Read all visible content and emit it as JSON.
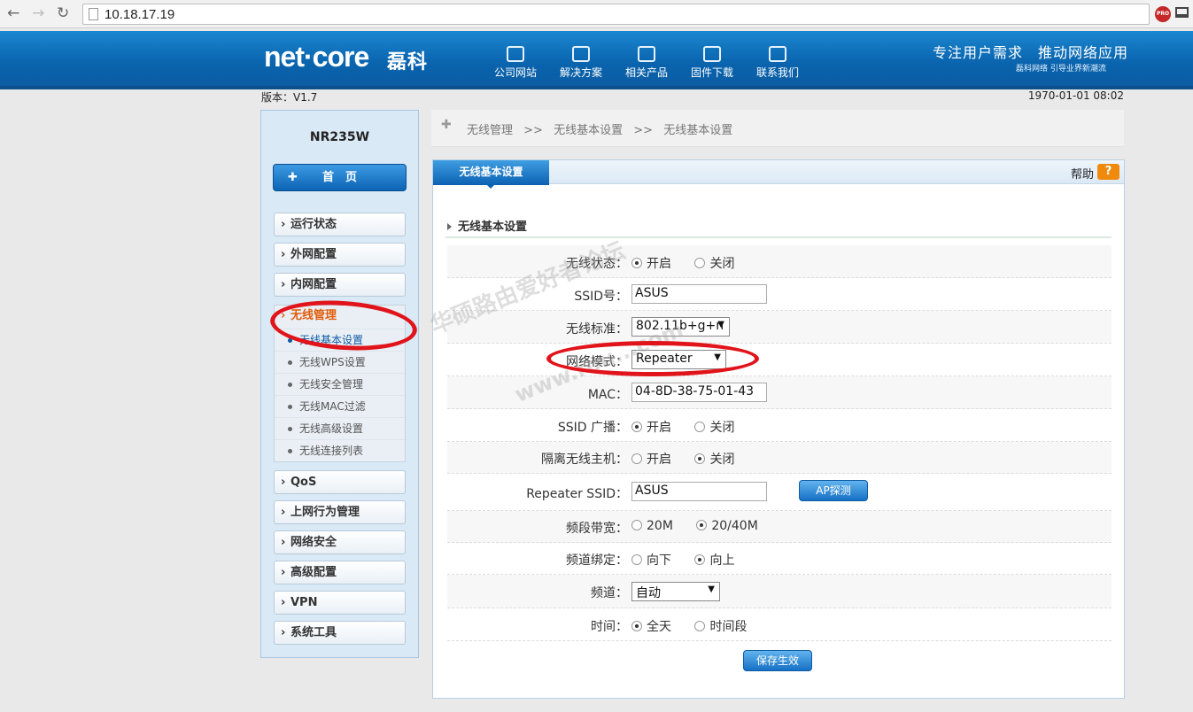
{
  "browser": {
    "url": "10.18.17.19",
    "ext_badge": "PRO"
  },
  "header": {
    "logo_text": "net·core",
    "logo_cn": "磊科",
    "nav": [
      "公司网站",
      "解决方案",
      "相关产品",
      "固件下载",
      "联系我们"
    ],
    "slogan": "专注用户需求　推动网络应用",
    "slogan_sub": "磊科网络 引导业界新潮流"
  },
  "meta": {
    "version": "版本：V1.7",
    "datetime": "1970-01-01 08:02"
  },
  "sidebar": {
    "device": "NR235W",
    "home": "首　页",
    "menu_top": [
      "运行状态",
      "外网配置",
      "内网配置"
    ],
    "open_menu": "无线管理",
    "sub_items": [
      "无线基本设置",
      "无线WPS设置",
      "无线安全管理",
      "无线MAC过滤",
      "无线高级设置",
      "无线连接列表"
    ],
    "menu_bottom": [
      "QoS",
      "上网行为管理",
      "网络安全",
      "高级配置",
      "VPN",
      "系统工具"
    ]
  },
  "breadcrumb": [
    "无线管理",
    ">>",
    "无线基本设置",
    ">>",
    "无线基本设置"
  ],
  "panel": {
    "tab": "无线基本设置",
    "help": "帮助",
    "help_icon": "?",
    "section_title": "无线基本设置"
  },
  "form": {
    "wireless_status": {
      "label": "无线状态：",
      "on": "开启",
      "off": "关闭"
    },
    "ssid": {
      "label": "SSID号：",
      "value": "ASUS"
    },
    "standard": {
      "label": "无线标准：",
      "value": "802.11b+g+n"
    },
    "mode": {
      "label": "网络模式：",
      "value": "Repeater"
    },
    "mac": {
      "label": "MAC：",
      "value": "04-8D-38-75-01-43"
    },
    "ssid_broadcast": {
      "label": "SSID 广播：",
      "on": "开启",
      "off": "关闭"
    },
    "isolation": {
      "label": "隔离无线主机：",
      "on": "开启",
      "off": "关闭"
    },
    "repeater_ssid": {
      "label": "Repeater SSID：",
      "value": "ASUS",
      "button": "AP探测"
    },
    "bandwidth": {
      "label": "频段带宽：",
      "opt1": "20M",
      "opt2": "20/40M"
    },
    "channel_bind": {
      "label": "频道绑定：",
      "opt1": "向下",
      "opt2": "向上"
    },
    "channel": {
      "label": "频道：",
      "value": "自动"
    },
    "time": {
      "label": "时间：",
      "opt1": "全天",
      "opt2": "时间段"
    },
    "save": "保存生效"
  },
  "watermark": {
    "line1": "华硕路由爱好者论坛",
    "line2": "www.rou...com"
  },
  "colors": {
    "header_blue": "#0a63ad",
    "accent_orange": "#e35d0b",
    "annotation_red": "#e0141a"
  }
}
